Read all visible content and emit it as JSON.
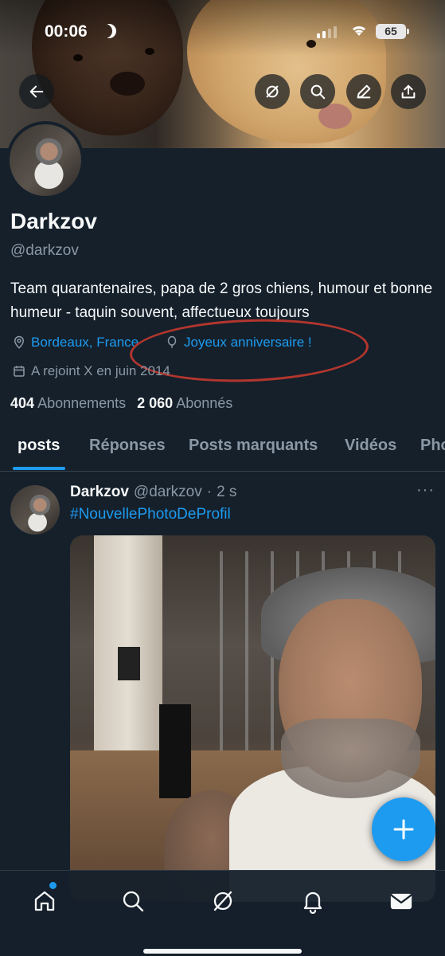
{
  "status_bar": {
    "time": "00:06",
    "battery": "65"
  },
  "profile": {
    "name": "Darkzov",
    "handle": "@darkzov",
    "bio": "Team quarantenaires, papa de 2 gros chiens, humour et bonne humeur - taquin souvent, affectueux toujours",
    "location": "Bordeaux, France",
    "birthday": "Joyeux anniversaire !",
    "joined": "A rejoint X en juin 2014",
    "following_count": "404",
    "following_label": "Abonnements",
    "followers_count": "2 060",
    "followers_label": "Abonnés"
  },
  "tabs": [
    {
      "label": "posts",
      "active": true
    },
    {
      "label": "Réponses"
    },
    {
      "label": "Posts marquants"
    },
    {
      "label": "Vidéos"
    },
    {
      "label": "Pho"
    }
  ],
  "post": {
    "author": "Darkzov",
    "handle": "@darkzov",
    "separator": "·",
    "time": "2 s",
    "more": "···",
    "text": "#NouvellePhotoDeProfil"
  },
  "fab": {
    "icon": "plus-icon"
  },
  "colors": {
    "background": "#15202b",
    "accent": "#1d9bf0",
    "muted": "#8b98a5",
    "annotation_ring": "#b3362d"
  }
}
